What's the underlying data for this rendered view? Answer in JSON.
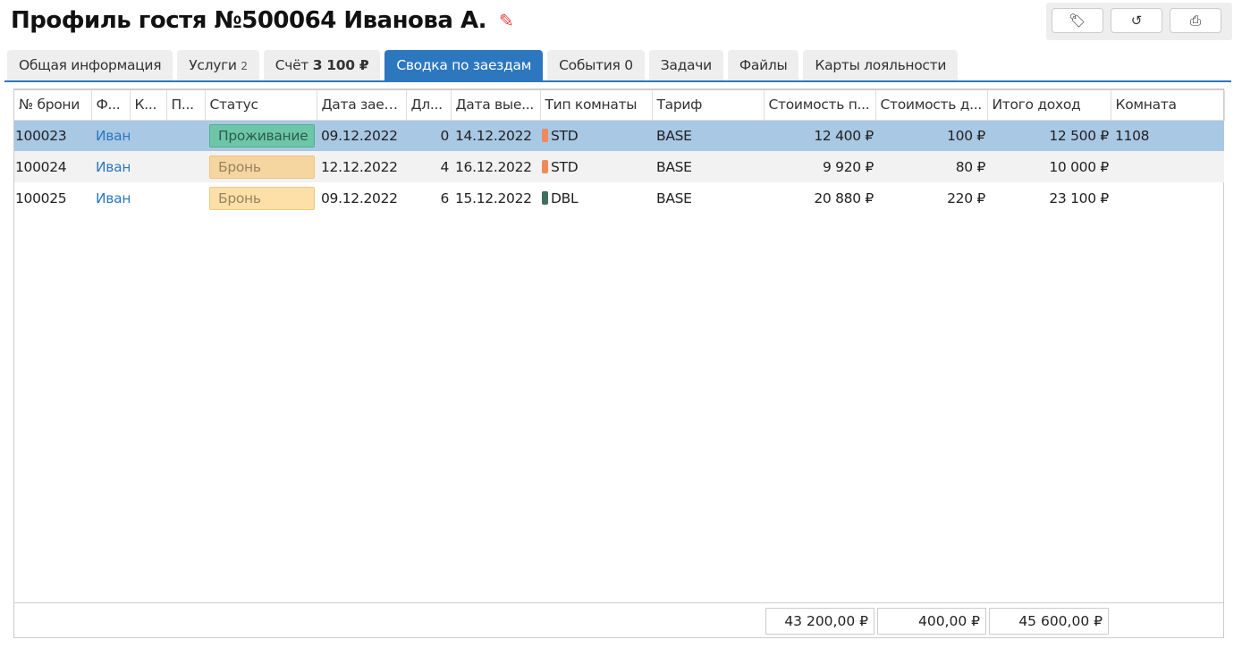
{
  "header": {
    "title": "Профиль гостя №500064 Иванова А."
  },
  "toolbar": [
    {
      "icon": "tags-icon",
      "glyph": "🏷"
    },
    {
      "icon": "history-icon",
      "glyph": "↺"
    },
    {
      "icon": "print-icon",
      "glyph": "⎙"
    }
  ],
  "tabs": [
    {
      "label": "Общая информация"
    },
    {
      "label": "Услуги",
      "sub": "2"
    },
    {
      "label": "Счёт",
      "bold": "3 100 ₽"
    },
    {
      "label": "Сводка по заездам",
      "active": true
    },
    {
      "label": "События 0"
    },
    {
      "label": "Задачи"
    },
    {
      "label": "Файлы"
    },
    {
      "label": "Карты лояльности"
    }
  ],
  "table": {
    "columns": [
      "№ брони",
      "Ф...",
      "К...",
      "П...",
      "Статус",
      "Дата заез...",
      "Дл...",
      "Дата вые...",
      "Тип комнаты",
      "Тариф",
      "Стоимость п...",
      "Стоимость д...",
      "Итого доход",
      "Комната"
    ],
    "rows": [
      {
        "booking": "100023",
        "name": "Иван",
        "k": "",
        "p": "",
        "status": "Проживание",
        "status_color": "#6ec6a8",
        "status_border": "#4fb08c",
        "status_text": "#2b5e4b",
        "arrival": "09.12.2022",
        "length": "0",
        "departure": "14.12.2022",
        "room_type": "STD",
        "room_color": "#ef8a5b",
        "tariff": "BASE",
        "cost_room": "12 400 ₽",
        "cost_extra": "100 ₽",
        "total": "12 500 ₽",
        "room": "1108",
        "state": "selected"
      },
      {
        "booking": "100024",
        "name": "Иван",
        "k": "",
        "p": "",
        "status": "Бронь",
        "status_color": "#f5d5a0",
        "status_border": "#f0c27a",
        "status_text": "#9a8460",
        "arrival": "12.12.2022",
        "length": "4",
        "departure": "16.12.2022",
        "room_type": "STD",
        "room_color": "#ef8a5b",
        "tariff": "BASE",
        "cost_room": "9 920 ₽",
        "cost_extra": "80 ₽",
        "total": "10 000 ₽",
        "room": "",
        "state": "alt"
      },
      {
        "booking": "100025",
        "name": "Иван",
        "k": "",
        "p": "",
        "status": "Бронь",
        "status_color": "#fde0a8",
        "status_border": "#f5c97a",
        "status_text": "#9a8460",
        "arrival": "09.12.2022",
        "length": "6",
        "departure": "15.12.2022",
        "room_type": "DBL",
        "room_color": "#3f6f5e",
        "tariff": "BASE",
        "cost_room": "20 880 ₽",
        "cost_extra": "220 ₽",
        "total": "23 100 ₽",
        "room": "",
        "state": ""
      }
    ],
    "totals": {
      "cost_room": "43 200,00 ₽",
      "cost_extra": "400,00 ₽",
      "total": "45 600,00 ₽"
    }
  }
}
